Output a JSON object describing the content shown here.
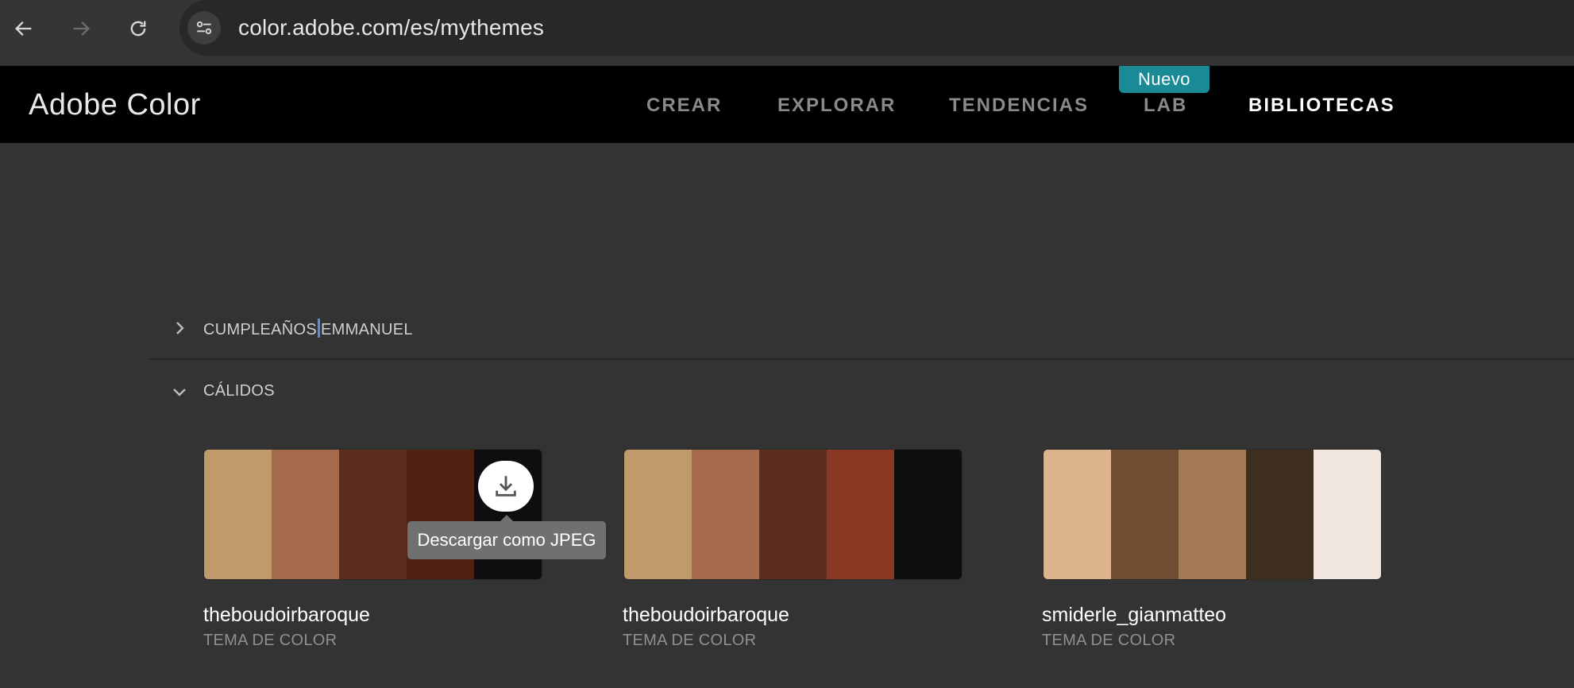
{
  "browser": {
    "url": "color.adobe.com/es/mythemes",
    "icons": [
      "back-arrow-icon",
      "forward-arrow-icon",
      "reload-icon",
      "site-settings-icon"
    ]
  },
  "header": {
    "brand": "Adobe Color",
    "nav": [
      "CREAR",
      "EXPLORAR",
      "TENDENCIAS",
      "LAB",
      "BIBLIOTECAS"
    ],
    "active": "BIBLIOTECAS",
    "badge": "Nuevo",
    "badge_color": "#1a8a96"
  },
  "libraries": {
    "sections": [
      {
        "title_part1": "CUMPLEAÑOS",
        "title_part2": "EMMANUEL",
        "expanded": false
      },
      {
        "title": "CÁLIDOS",
        "expanded": true
      }
    ]
  },
  "themes": [
    {
      "name": "theboudoirbaroque",
      "subtitle": "TEMA DE COLOR",
      "colors": [
        "#C19A6B",
        "#A56B4C",
        "#5A2D1C",
        "#4F2212",
        "#0E0E0E"
      ]
    },
    {
      "name": "theboudoirbaroque",
      "subtitle": "TEMA DE COLOR",
      "colors": [
        "#C19A6B",
        "#A56B4C",
        "#5A2D1C",
        "#8A3723",
        "#0E0E0E"
      ]
    },
    {
      "name": "smiderle_gianmatteo",
      "subtitle": "TEMA DE COLOR",
      "colors": [
        "#DBB48C",
        "#704D33",
        "#A47A54",
        "#3E2E20",
        "#F0E6DD"
      ]
    }
  ],
  "tooltip": {
    "text": "Descargar como JPEG"
  }
}
